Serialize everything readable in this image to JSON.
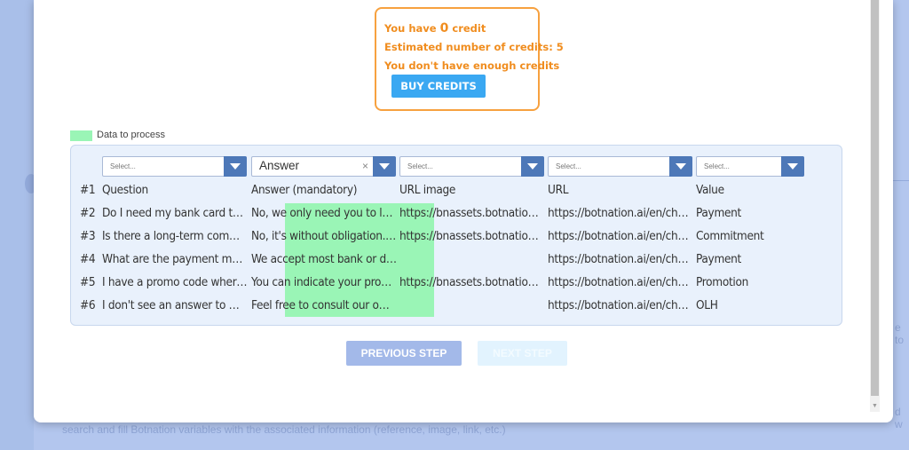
{
  "background": {
    "footer_text": "search and fill Botnation variables with the associated information (reference, image, link, etc.)",
    "right_text_1": "e to",
    "right_text_2": "d w"
  },
  "credits": {
    "have_prefix": "You have",
    "credit_count": "0",
    "have_suffix": "credit",
    "estimated": "Estimated number of credits: 5",
    "warning": "You don't have enough credits",
    "buy_label": "BUY CREDITS"
  },
  "legend": {
    "label": "Data to process"
  },
  "mapping": {
    "selects": [
      {
        "value": "Select..."
      },
      {
        "value": "Answer",
        "clear": "×"
      },
      {
        "value": "Select..."
      },
      {
        "value": "Select..."
      },
      {
        "value": "Select..."
      }
    ]
  },
  "table": {
    "rows": [
      {
        "num": "#1",
        "cells": [
          "Question",
          "Answer (mandatory)",
          "URL image",
          "URL",
          "Value"
        ]
      },
      {
        "num": "#2",
        "cells": [
          "Do I need my bank card to…",
          "No, we only need you to lo…",
          "https://bnassets.botnatio…",
          "https://botnation.ai/en/ch…",
          "Payment"
        ]
      },
      {
        "num": "#3",
        "cells": [
          "Is there a long-term com…",
          "No, it's without obligation.…",
          "https://bnassets.botnatio…",
          "https://botnation.ai/en/ch…",
          "Commitment"
        ]
      },
      {
        "num": "#4",
        "cells": [
          "What are the payment me…",
          "We accept most bank or d…",
          "",
          "https://botnation.ai/en/ch…",
          "Payment"
        ]
      },
      {
        "num": "#5",
        "cells": [
          "I have a promo code wher…",
          "You can indicate your pro…",
          "https://bnassets.botnatio…",
          "https://botnation.ai/en/ch…",
          "Promotion"
        ]
      },
      {
        "num": "#6",
        "cells": [
          "I don't see an answer to m…",
          "Feel free to consult our o…",
          "",
          "https://botnation.ai/en/ch…",
          "OLH"
        ]
      }
    ]
  },
  "nav": {
    "previous_label": "PREVIOUS STEP",
    "next_label": "NEXT STEP"
  },
  "colors": {
    "accent": "#3aa8f2",
    "warning": "#f08d1f",
    "data_highlight": "#9af5b6",
    "select_arrow": "#4d78b8"
  }
}
